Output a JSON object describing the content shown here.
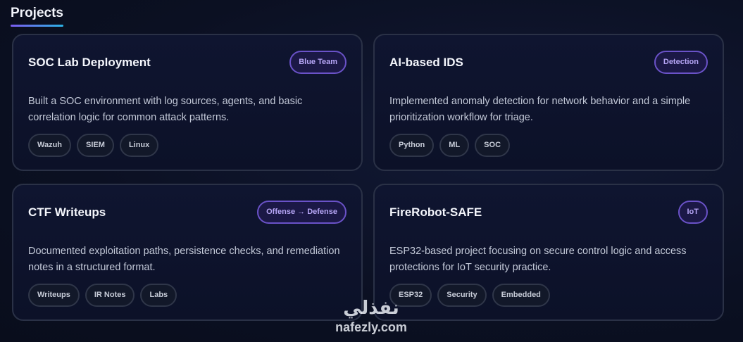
{
  "section": {
    "title": "Projects"
  },
  "projects": [
    {
      "title": "SOC Lab Deployment",
      "badge": "Blue Team",
      "description": "Built a SOC environment with log sources, agents, and basic correlation logic for common attack patterns.",
      "tags": [
        "Wazuh",
        "SIEM",
        "Linux"
      ]
    },
    {
      "title": "AI-based IDS",
      "badge": "Detection",
      "description": "Implemented anomaly detection for network behavior and a simple prioritization workflow for triage.",
      "tags": [
        "Python",
        "ML",
        "SOC"
      ]
    },
    {
      "title": "CTF Writeups",
      "badge": "Offense → Defense",
      "description": "Documented exploitation paths, persistence checks, and remediation notes in a structured format.",
      "tags": [
        "Writeups",
        "IR Notes",
        "Labs"
      ]
    },
    {
      "title": "FireRobot-SAFE",
      "badge": "IoT",
      "description": "ESP32-based project focusing on secure control logic and access protections for IoT security practice.",
      "tags": [
        "ESP32",
        "Security",
        "Embedded"
      ]
    }
  ],
  "watermark": {
    "logo_ar": "نفذلي",
    "logo_en": "nafezly.com"
  },
  "colors": {
    "background": "#0b1022",
    "accent_purple": "#7c5cf0",
    "accent_cyan": "#2bb3e6",
    "badge_text": "#b7a6f7"
  }
}
